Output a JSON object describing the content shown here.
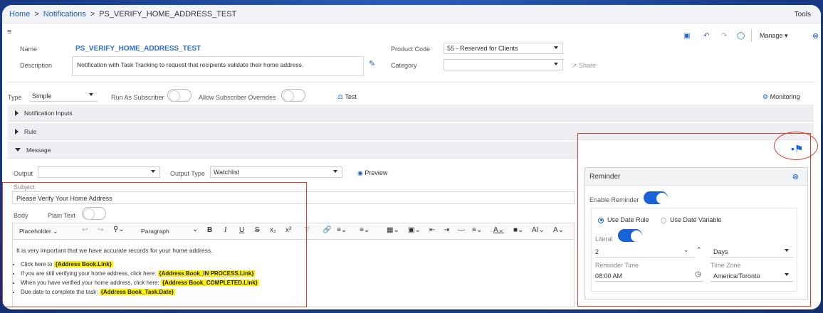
{
  "breadcrumb": {
    "home": "Home",
    "notifications": "Notifications",
    "current": "PS_VERIFY_HOME_ADDRESS_TEST",
    "sep": ">",
    "tools": "Tools"
  },
  "header": {
    "name_label": "Name",
    "name_value": "PS_VERIFY_HOME_ADDRESS_TEST",
    "desc_label": "Description",
    "desc_value": "Notification with Task Tracking to request that recipients validate their home address.",
    "product_code_label": "Product Code",
    "product_code_value": "55 - Reserved for Clients",
    "category_label": "Category",
    "category_value": "",
    "share_label": "Share",
    "manage_label": "Manage"
  },
  "settings": {
    "type_label": "Type",
    "type_value": "Simple",
    "run_as_label": "Run As Subscriber",
    "allow_label": "Allow Subscriber Overrides",
    "test_label": "Test",
    "monitoring_label": "Monitoring"
  },
  "sections": {
    "inputs": "Notification Inputs",
    "rule": "Rule",
    "message": "Message"
  },
  "message": {
    "output_label": "Output",
    "output_value": "",
    "output_type_label": "Output Type",
    "output_type_value": "Watchlist",
    "preview_label": "Preview",
    "subject_label": "Subject",
    "subject_value": "Please Verify Your Home Address",
    "body_label": "Body",
    "plain_text_label": "Plain Text"
  },
  "toolbar": {
    "placeholder": "Placeholder",
    "paragraph": "Paragraph"
  },
  "body": {
    "intro": "It is very important that we have accurate records for your home address.",
    "items": [
      {
        "text": "Click here to ",
        "token": "{Address Book.Link}"
      },
      {
        "text": "If you are still verifying your home address, click here: ",
        "token": "{Address Book_IN PROCESS.Link}"
      },
      {
        "text": "When you have verified your home address, click here: ",
        "token": "{Address Book_COMPLETED.Link}"
      },
      {
        "text": "Due date to complete the task: ",
        "token": "{Address Book_Task.Date}"
      }
    ]
  },
  "reminder": {
    "title": "Reminder",
    "enable_label": "Enable Reminder",
    "use_date_rule": "Use Date Rule",
    "use_date_variable": "Use Date Variable",
    "literal_label": "Literal",
    "amount": "2",
    "unit": "Days",
    "time_label": "Reminder Time",
    "time_value": "08:00 AM",
    "tz_label": "Time Zone",
    "tz_value": "America/Toronto"
  },
  "colors": {
    "accent": "#1a63d6",
    "highlight": "#fff200",
    "annotation": "#e03b2e"
  }
}
